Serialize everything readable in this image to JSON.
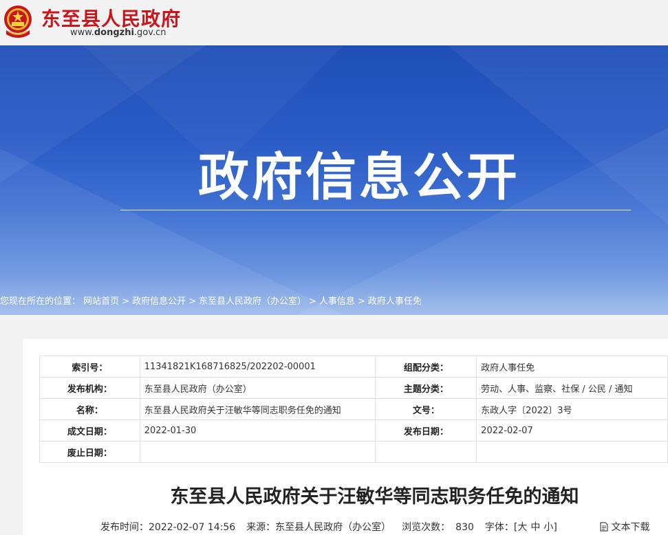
{
  "site": {
    "title": "东至县人民政府",
    "url_prefix": "www.",
    "url_domain": "dongzhi",
    "url_suffix": ".gov.cn"
  },
  "banner": {
    "title": "政府信息公开"
  },
  "breadcrumb": {
    "prefix": "您现在所在的位置：",
    "items": [
      "网站首页",
      "政府信息公开",
      "东至县人民政府（办公室）",
      "人事信息",
      "政府人事任免"
    ],
    "separator": ">"
  },
  "meta": {
    "rows": [
      {
        "l1": "索引号：",
        "v1": "11341821K168716825/202202-00001",
        "l2": "组配分类：",
        "v2": "政府人事任免"
      },
      {
        "l1": "发布机构：",
        "v1": "东至县人民政府（办公室）",
        "l2": "主题分类：",
        "v2": "劳动、人事、监察、社保 / 公民 / 通知"
      },
      {
        "l1": "名称：",
        "v1": "东至县人民政府关于汪敏华等同志职务任免的通知",
        "l2": "文号：",
        "v2": "东政人字〔2022〕3号"
      },
      {
        "l1": "成文日期：",
        "v1": "2022-01-30",
        "l2": "发布日期：",
        "v2": "2022-02-07"
      },
      {
        "l1": "废止日期：",
        "v1": "",
        "l2": "",
        "v2": ""
      }
    ]
  },
  "article": {
    "title": "东至县人民政府关于汪敏华等同志职务任免的通知",
    "publish_label": "发布时间：",
    "publish_time": "2022-02-07 14:56",
    "source_label": "来源：",
    "source": "东至县人民政府（办公室）",
    "views_label": "浏览次数：",
    "views": "830",
    "font_label": "字体：",
    "font_open": "[",
    "font_large": "大",
    "font_medium": "中",
    "font_small": "小",
    "font_close": "]",
    "download": "文本下载"
  },
  "colors": {
    "brand_red": "#c8161d",
    "banner_blue": "#1f4fb6"
  },
  "icons": {
    "emblem": "national-emblem-icon",
    "download": "document-icon"
  }
}
